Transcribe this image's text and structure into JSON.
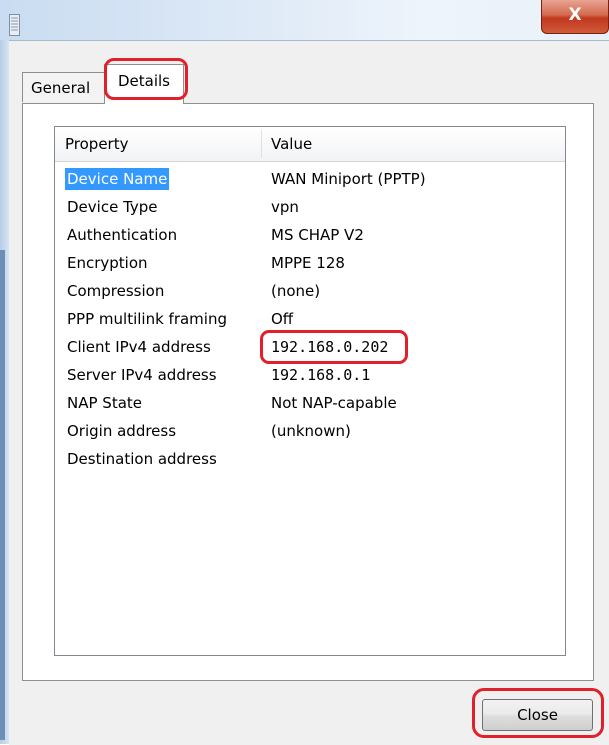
{
  "window": {
    "close_glyph": "X"
  },
  "tabs": [
    {
      "label": "General",
      "active": false
    },
    {
      "label": "Details",
      "active": true
    }
  ],
  "details": {
    "columns": [
      "Property",
      "Value"
    ],
    "rows": [
      {
        "property": "Device Name",
        "value": "WAN Miniport (PPTP)",
        "selected": true
      },
      {
        "property": "Device Type",
        "value": "vpn"
      },
      {
        "property": "Authentication",
        "value": "MS CHAP V2"
      },
      {
        "property": "Encryption",
        "value": "MPPE 128"
      },
      {
        "property": "Compression",
        "value": "(none)"
      },
      {
        "property": "PPP multilink framing",
        "value": "Off"
      },
      {
        "property": "Client IPv4 address",
        "value": "192.168.0.202"
      },
      {
        "property": "Server IPv4 address",
        "value": "192.168.0.1"
      },
      {
        "property": "NAP State",
        "value": "Not NAP-capable"
      },
      {
        "property": "Origin address",
        "value": "(unknown)"
      },
      {
        "property": "Destination address",
        "value": ""
      }
    ]
  },
  "buttons": {
    "close_label": "Close"
  },
  "colors": {
    "highlight": "#e0202a",
    "selection": "#3399ff"
  }
}
